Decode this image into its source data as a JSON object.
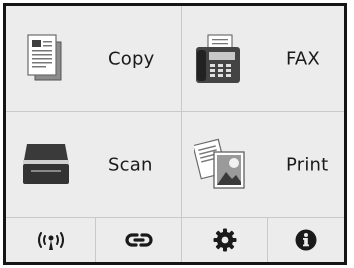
{
  "tiles": {
    "copy": {
      "label": "Copy",
      "icon": "copy-icon"
    },
    "fax": {
      "label": "FAX",
      "icon": "fax-icon"
    },
    "scan": {
      "label": "Scan",
      "icon": "scanner-icon"
    },
    "print": {
      "label": "Print",
      "icon": "photo-print-icon"
    }
  },
  "bottom_bar": [
    "wireless-icon",
    "link-icon",
    "gear-icon",
    "info-icon"
  ]
}
